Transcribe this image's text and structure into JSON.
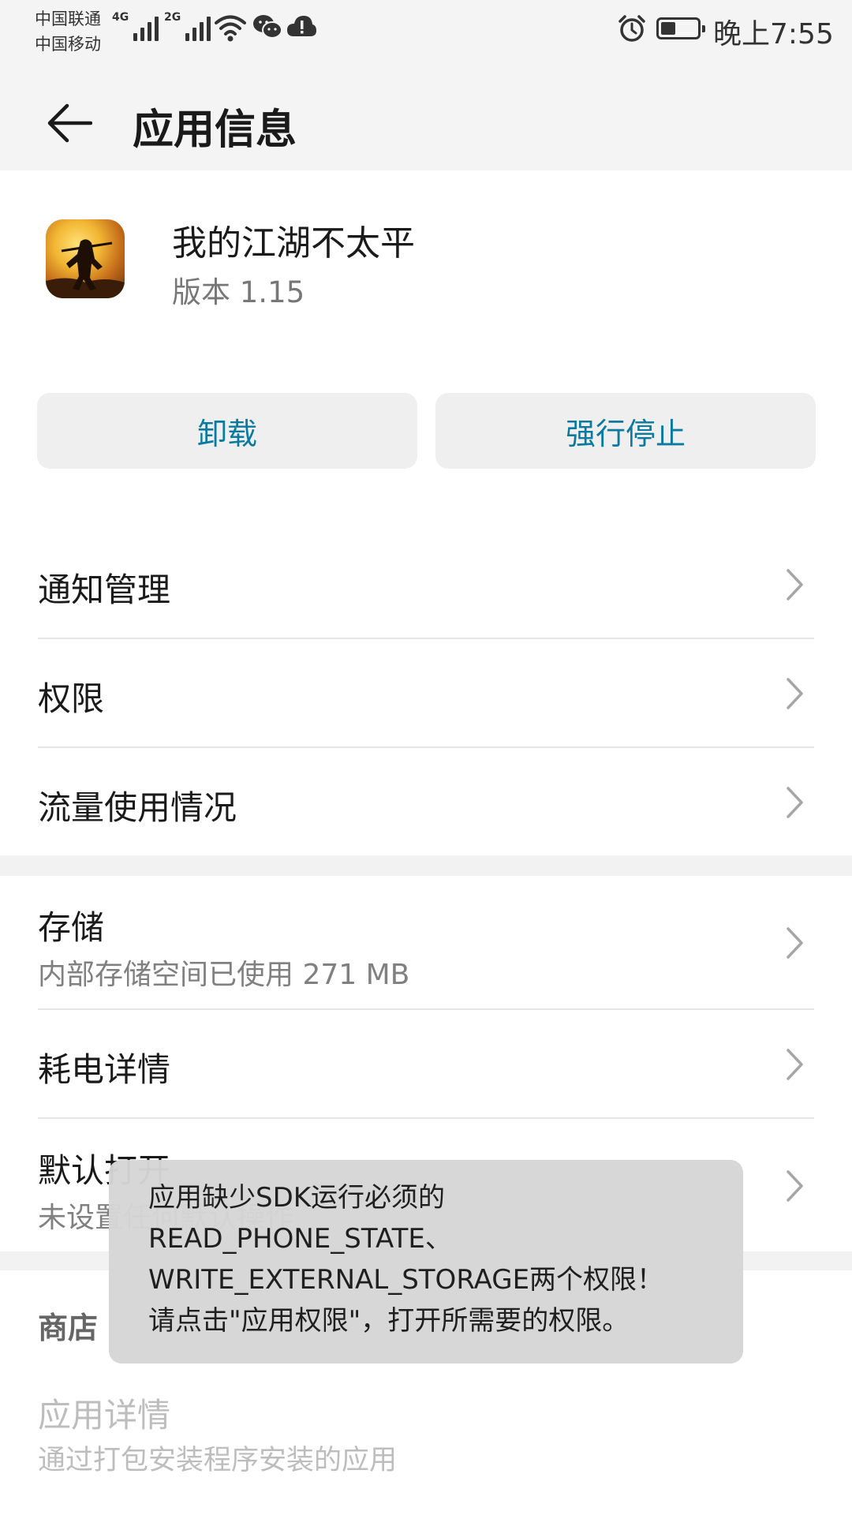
{
  "status_bar": {
    "carrier_1": "中国联通",
    "carrier_2": "中国移动",
    "network_1": "4G",
    "network_2": "2G",
    "time": "晚上7:55",
    "icons": [
      "signal-icon",
      "wifi-icon",
      "wechat-icon",
      "cloud-alert-icon",
      "alarm-icon",
      "battery-icon"
    ]
  },
  "app_bar": {
    "title": "应用信息",
    "back_icon": "back-arrow-icon"
  },
  "app": {
    "name": "我的江湖不太平",
    "version": "版本 1.15"
  },
  "buttons": {
    "uninstall": "卸载",
    "force_stop": "强行停止",
    "accent_color": "#0b7aa0"
  },
  "list": {
    "notification": "通知管理",
    "permissions": "权限",
    "data_usage": "流量使用情况",
    "storage": "存储",
    "storage_sub": "内部存储空间已使用 271 MB",
    "battery": "耗电详情",
    "open_by_default": "默认打开",
    "open_by_default_sub": "未设置任何默认操作"
  },
  "store": {
    "section": "商店",
    "detail_title": "应用详情",
    "detail_sub": "通过打包安装程序安装的应用"
  },
  "toast": {
    "line_1": "应用缺少SDK运行必须的",
    "line_2": "READ_PHONE_STATE、",
    "line_3": "WRITE_EXTERNAL_STORAGE两个权限！",
    "line_4": "请点击\"应用权限\"，打开所需要的权限。"
  }
}
